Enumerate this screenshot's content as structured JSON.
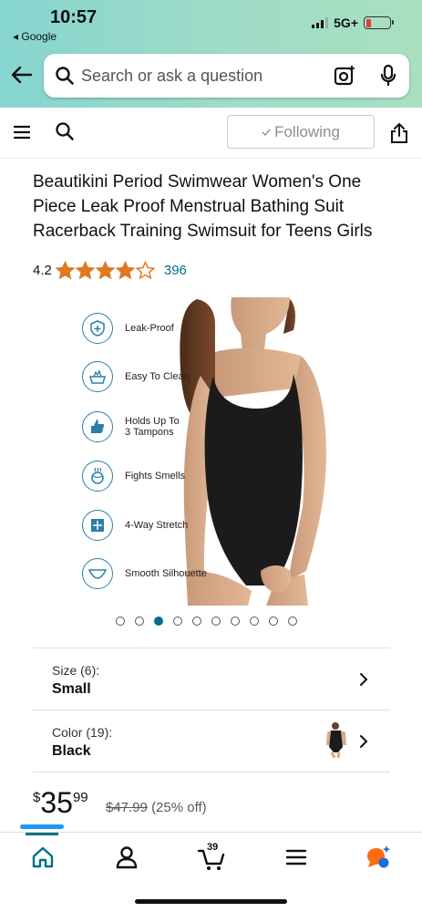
{
  "status_bar": {
    "time": "10:57",
    "back_app": "◂ Google",
    "network": "5G+",
    "battery_level": 0.2
  },
  "search": {
    "placeholder": "Search or ask a question"
  },
  "toolbar": {
    "following_label": "Following"
  },
  "product": {
    "title": "Beautikini Period Swimwear Women's One Piece Leak Proof Menstrual Bathing Suit Racerback Training Swimsuit for Teens Girls",
    "rating": "4.2",
    "stars_filled": 4.2,
    "rating_count": "396",
    "features": [
      {
        "icon": "shield-plus-icon",
        "label": "Leak-Proof"
      },
      {
        "icon": "wash-basin-icon",
        "label": "Easy To Clean"
      },
      {
        "icon": "thumbs-up-icon",
        "label": "Holds Up To\n3 Tampons"
      },
      {
        "icon": "odor-ball-icon",
        "label": "Fights Smells"
      },
      {
        "icon": "stretch-arrows-icon",
        "label": "4-Way Stretch"
      },
      {
        "icon": "underwear-icon",
        "label": "Smooth Silhouette"
      }
    ],
    "image_count": 10,
    "image_index": 2
  },
  "variations": {
    "size": {
      "label": "Size (6):",
      "value": "Small"
    },
    "color": {
      "label": "Color (19):",
      "value": "Black"
    }
  },
  "price": {
    "symbol": "$",
    "whole": "35",
    "fraction": "99",
    "list_price": "$47.99",
    "discount": "(25% off)"
  },
  "cart": {
    "count": "39"
  },
  "colors": {
    "teal": "#007185",
    "star": "#de7921",
    "header_start": "#86d5d0",
    "header_end": "#a8e0c0"
  }
}
